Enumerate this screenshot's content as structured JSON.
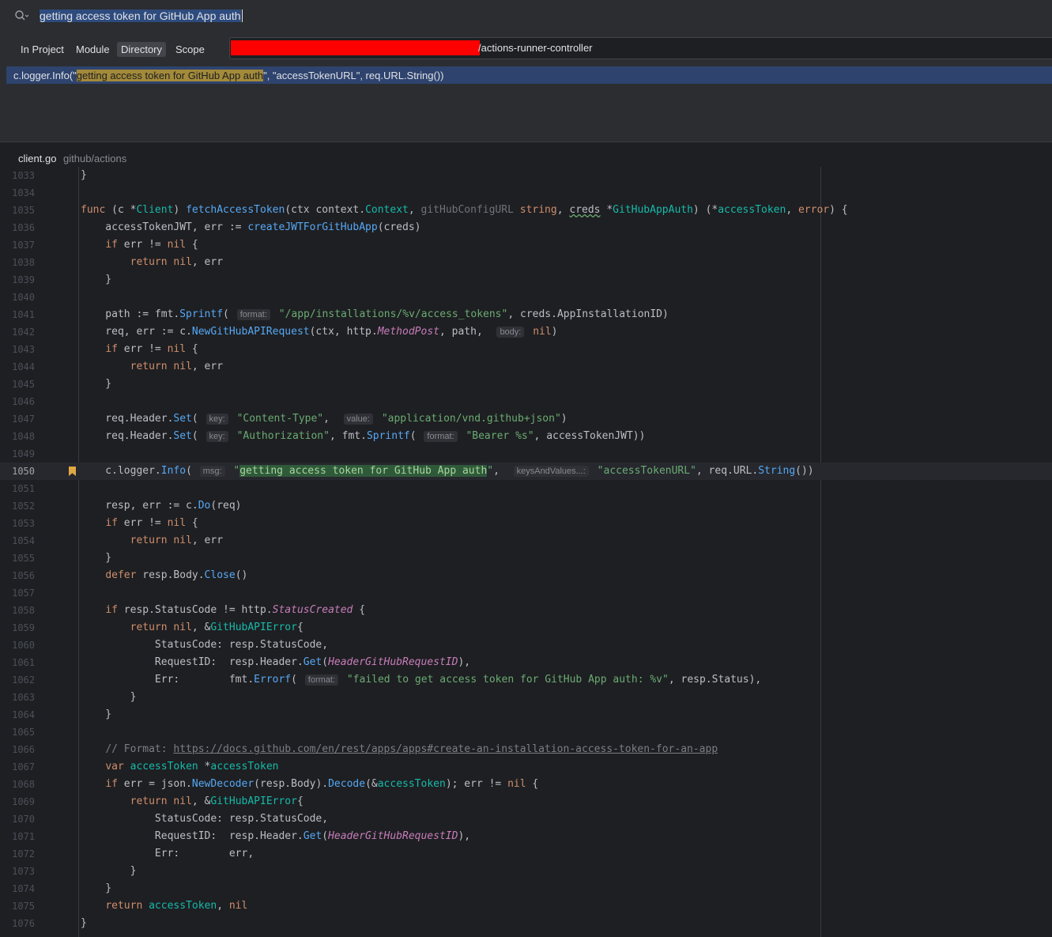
{
  "search": {
    "query": "getting access token for GitHub App auth"
  },
  "scope_tabs": [
    "In Project",
    "Module",
    "Directory",
    "Scope"
  ],
  "active_scope": "Directory",
  "directory": {
    "path_visible": "/actions-runner-controller"
  },
  "result": {
    "prefix": "c.logger.Info(\"",
    "match": "getting access token for GitHub App auth",
    "suffix": "\", \"accessTokenURL\", req.URL.String())"
  },
  "file": {
    "name": "client.go",
    "path": "github/actions"
  },
  "editor": {
    "current_line": 1050,
    "lines": [
      {
        "n": 1033,
        "t": "}"
      },
      {
        "n": 1034,
        "t": ""
      },
      {
        "n": 1035,
        "t": "func (c *Client) fetchAccessToken(ctx context.Context, gitHubConfigURL string, creds *GitHubAppAuth) (*accessToken, error) {"
      },
      {
        "n": 1036,
        "t": "    accessTokenJWT, err := createJWTForGitHubApp(creds)"
      },
      {
        "n": 1037,
        "t": "    if err != nil {"
      },
      {
        "n": 1038,
        "t": "        return nil, err"
      },
      {
        "n": 1039,
        "t": "    }"
      },
      {
        "n": 1040,
        "t": ""
      },
      {
        "n": 1041,
        "t": "    path := fmt.Sprintf( format: \"/app/installations/%v/access_tokens\", creds.AppInstallationID)"
      },
      {
        "n": 1042,
        "t": "    req, err := c.NewGitHubAPIRequest(ctx, http.MethodPost, path,  body: nil)"
      },
      {
        "n": 1043,
        "t": "    if err != nil {"
      },
      {
        "n": 1044,
        "t": "        return nil, err"
      },
      {
        "n": 1045,
        "t": "    }"
      },
      {
        "n": 1046,
        "t": ""
      },
      {
        "n": 1047,
        "t": "    req.Header.Set( key: \"Content-Type\",  value: \"application/vnd.github+json\")"
      },
      {
        "n": 1048,
        "t": "    req.Header.Set( key: \"Authorization\", fmt.Sprintf( format: \"Bearer %s\", accessTokenJWT))"
      },
      {
        "n": 1049,
        "t": ""
      },
      {
        "n": 1050,
        "t": "    c.logger.Info( msg: \"getting access token for GitHub App auth\",  keysAndValues...: \"accessTokenURL\", req.URL.String())"
      },
      {
        "n": 1051,
        "t": ""
      },
      {
        "n": 1052,
        "t": "    resp, err := c.Do(req)"
      },
      {
        "n": 1053,
        "t": "    if err != nil {"
      },
      {
        "n": 1054,
        "t": "        return nil, err"
      },
      {
        "n": 1055,
        "t": "    }"
      },
      {
        "n": 1056,
        "t": "    defer resp.Body.Close()"
      },
      {
        "n": 1057,
        "t": ""
      },
      {
        "n": 1058,
        "t": "    if resp.StatusCode != http.StatusCreated {"
      },
      {
        "n": 1059,
        "t": "        return nil, &GitHubAPIError{"
      },
      {
        "n": 1060,
        "t": "            StatusCode: resp.StatusCode,"
      },
      {
        "n": 1061,
        "t": "            RequestID:  resp.Header.Get(HeaderGitHubRequestID),"
      },
      {
        "n": 1062,
        "t": "            Err:        fmt.Errorf( format: \"failed to get access token for GitHub App auth: %v\", resp.Status),"
      },
      {
        "n": 1063,
        "t": "        }"
      },
      {
        "n": 1064,
        "t": "    }"
      },
      {
        "n": 1065,
        "t": ""
      },
      {
        "n": 1066,
        "t": "    // Format: https://docs.github.com/en/rest/apps/apps#create-an-installation-access-token-for-an-app"
      },
      {
        "n": 1067,
        "t": "    var accessToken *accessToken"
      },
      {
        "n": 1068,
        "t": "    if err = json.NewDecoder(resp.Body).Decode(&accessToken); err != nil {"
      },
      {
        "n": 1069,
        "t": "        return nil, &GitHubAPIError{"
      },
      {
        "n": 1070,
        "t": "            StatusCode: resp.StatusCode,"
      },
      {
        "n": 1071,
        "t": "            RequestID:  resp.Header.Get(HeaderGitHubRequestID),"
      },
      {
        "n": 1072,
        "t": "            Err:        err,"
      },
      {
        "n": 1073,
        "t": "        }"
      },
      {
        "n": 1074,
        "t": "    }"
      },
      {
        "n": 1075,
        "t": "    return accessToken, nil"
      },
      {
        "n": 1076,
        "t": "}"
      }
    ]
  },
  "colors": {
    "background": "#1e1f22",
    "panel": "#2b2d30",
    "selection": "#2e436e",
    "match_highlight": "#a38a3a",
    "keyword": "#cf8e6d",
    "function": "#56a8f5",
    "string": "#6aab73",
    "bookmark": "#e0a843"
  },
  "icons": {
    "search": "search-icon",
    "bookmark": "bookmark-icon"
  }
}
